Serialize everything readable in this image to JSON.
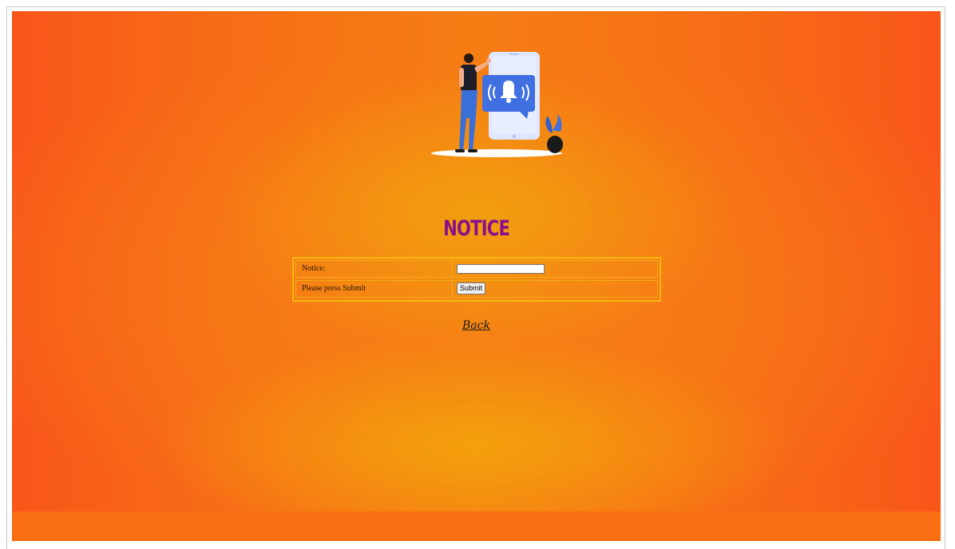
{
  "page": {
    "title": "NOTICE",
    "back_link": "Back"
  },
  "form": {
    "rows": [
      {
        "label": "Notice:",
        "input_value": ""
      },
      {
        "label": "Please press Submit",
        "button_label": "Submit"
      }
    ]
  },
  "illustration": {
    "name": "person-with-phone-notification-bell",
    "icons": [
      "bell-icon",
      "smartphone",
      "person",
      "plant-pot"
    ]
  },
  "colors": {
    "background_orange": "#f76c16",
    "background_center": "#f2a00e",
    "title_purple": "#8a0f8a",
    "table_border": "#f6b611"
  }
}
